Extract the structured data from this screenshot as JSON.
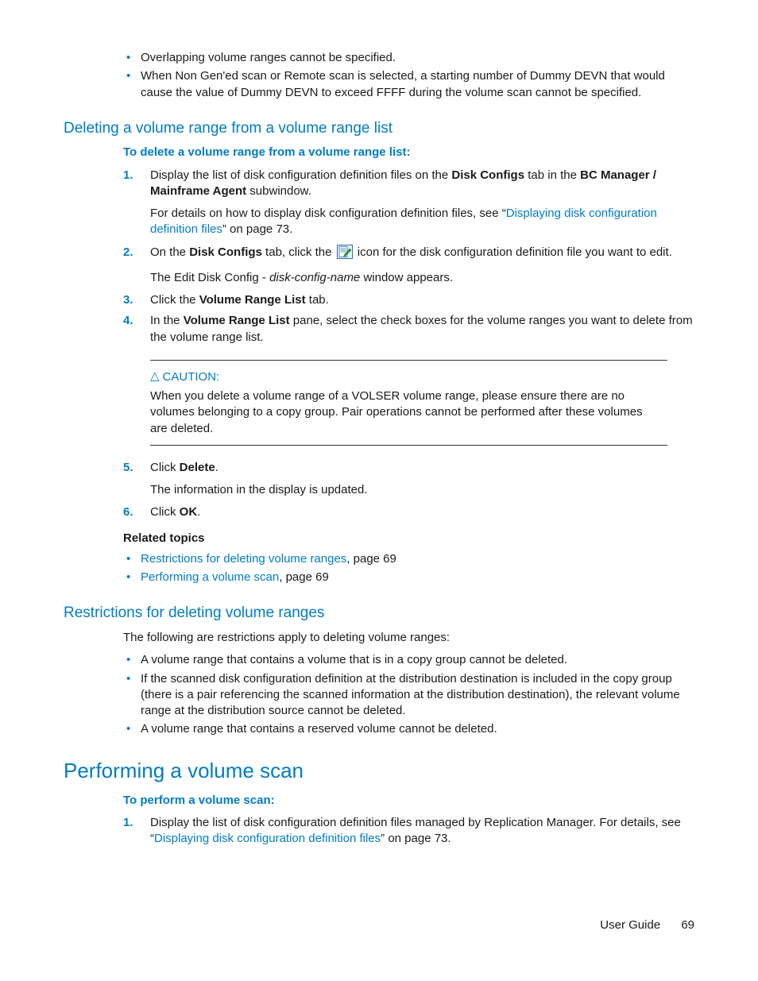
{
  "intro_bullets": [
    "Overlapping volume ranges cannot be specified.",
    "When Non Gen'ed scan or Remote scan is selected, a starting number of Dummy DEVN that would cause the value of Dummy DEVN to exceed FFFF during the volume scan cannot be specified."
  ],
  "sec1": {
    "heading": "Deleting a volume range from a volume range list",
    "proc_head": "To delete a volume range from a volume range list:",
    "steps": {
      "s1a": "Display the list of disk configuration definition files on the ",
      "s1b": "Disk Configs",
      "s1c": " tab in the ",
      "s1d": "BC Manager / Mainframe Agent",
      "s1e": " subwindow.",
      "s1fa": "For details on how to display disk configuration definition files, see “",
      "s1fb": "Displaying disk configuration definition files",
      "s1fc": "” on page 73.",
      "s2a": "On the ",
      "s2b": "Disk Configs",
      "s2c": " tab, click the ",
      "s2d": " icon for the disk configuration definition file you want to edit.",
      "s2ea": "The Edit Disk Config - ",
      "s2eb": "disk-config-name",
      "s2ec": " window appears.",
      "s3a": "Click the ",
      "s3b": "Volume Range List",
      "s3c": " tab.",
      "s4a": "In the ",
      "s4b": "Volume Range List",
      "s4c": " pane, select the check boxes for the volume ranges you want to delete from the volume range list.",
      "caution_label": "CAUTION:",
      "caution_text": "When you delete a volume range of a VOLSER volume range, please ensure there are no volumes belonging to a copy group. Pair operations cannot be performed after these volumes are deleted.",
      "s5a": "Click ",
      "s5b": "Delete",
      "s5c": ".",
      "s5d": "The information in the display is updated.",
      "s6a": "Click ",
      "s6b": "OK",
      "s6c": "."
    },
    "related_head": "Related topics",
    "related": [
      {
        "link": "Restrictions for deleting volume ranges",
        "suffix": ", page 69"
      },
      {
        "link": "Performing a volume scan",
        "suffix": ", page 69"
      }
    ]
  },
  "sec2": {
    "heading": "Restrictions for deleting volume ranges",
    "intro": "The following are restrictions apply to deleting volume ranges:",
    "bullets": [
      "A volume range that contains a volume that is in a copy group cannot be deleted.",
      "If the scanned disk configuration definition at the distribution destination is included in the copy group (there is a pair referencing the scanned information at the distribution destination), the relevant volume range at the distribution source cannot be deleted.",
      "A volume range that contains a reserved volume cannot be deleted."
    ]
  },
  "sec3": {
    "heading": "Performing a volume scan",
    "proc_head": "To perform a volume scan:",
    "s1a": "Display the list of disk configuration definition files managed by Replication Manager. For details, see “",
    "s1b": "Displaying disk configuration definition files",
    "s1c": "” on page 73."
  },
  "footer": {
    "label": "User Guide",
    "page": "69"
  }
}
